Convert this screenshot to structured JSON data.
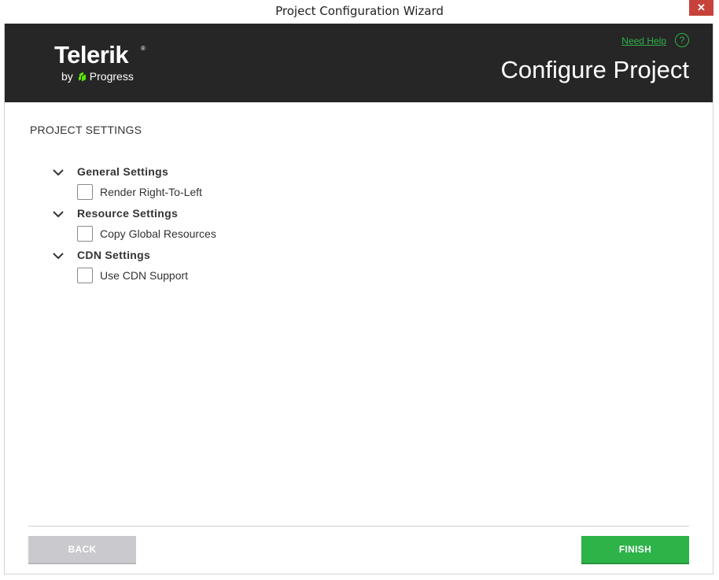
{
  "window": {
    "title": "Project Configuration Wizard",
    "close_glyph": "✕"
  },
  "header": {
    "brand": "Telerik",
    "brand_mark": "®",
    "by": "by",
    "company": "Progress",
    "help_link": "Need Help",
    "help_glyph": "?",
    "page_title": "Configure Project"
  },
  "section": {
    "heading": "PROJECT SETTINGS"
  },
  "groups": [
    {
      "label": "General Settings",
      "option_label": "Render Right-To-Left",
      "checked": false
    },
    {
      "label": "Resource Settings",
      "option_label": "Copy Global Resources",
      "checked": false
    },
    {
      "label": "CDN Settings",
      "option_label": "Use CDN Support",
      "checked": false
    }
  ],
  "footer": {
    "back_label": "BACK",
    "finish_label": "FINISH"
  },
  "colors": {
    "header_bg": "#262626",
    "accent_green": "#2db348",
    "close_red": "#c7423b",
    "back_disabled": "#c9c9ce"
  },
  "icons": {
    "close": "close-icon",
    "help": "help-circle-icon",
    "chevron": "chevron-down-icon",
    "logo_mark": "progress-logo-icon"
  }
}
